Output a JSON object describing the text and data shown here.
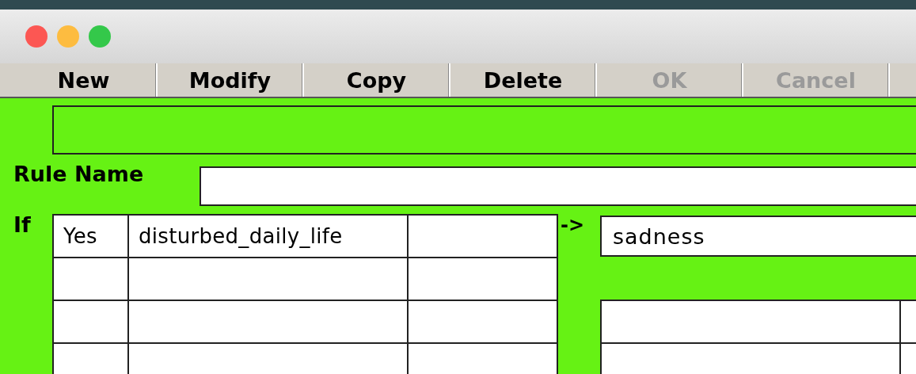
{
  "toolbar": [
    {
      "label": "New",
      "disabled": false
    },
    {
      "label": "Modify",
      "disabled": false
    },
    {
      "label": "Copy",
      "disabled": false
    },
    {
      "label": "Delete",
      "disabled": false
    },
    {
      "label": "OK",
      "disabled": true
    },
    {
      "label": "Cancel",
      "disabled": true
    }
  ],
  "rule_name": {
    "label": "Rule Name"
  },
  "conditions": {
    "label": "If",
    "rows": [
      {
        "answer": "Yes",
        "attribute": "disturbed_daily_life"
      },
      {},
      {},
      {}
    ]
  },
  "arrow": "->",
  "conclusion": {
    "value": "sadness",
    "rows": [
      {},
      {}
    ]
  }
}
